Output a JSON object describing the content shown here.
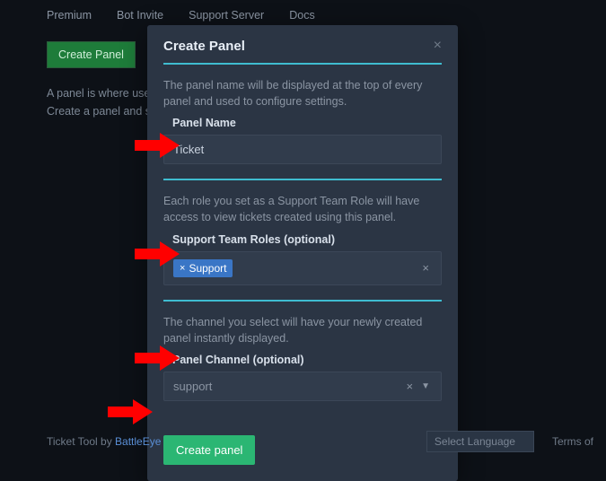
{
  "nav": {
    "premium": "Premium",
    "bot_invite": "Bot Invite",
    "support_server": "Support Server",
    "docs": "Docs"
  },
  "page": {
    "create_panel_btn": "Create Panel",
    "desc_line1": "A panel is where users c",
    "desc_line2": "Create a panel and sen"
  },
  "modal": {
    "title": "Create Panel",
    "section1": {
      "desc": "The panel name will be displayed at the top of every panel and used to configure settings.",
      "label": "Panel Name",
      "value": "Ticket"
    },
    "section2": {
      "desc": "Each role you set as a Support Team Role will have access to view tickets created using this panel.",
      "label": "Support Team Roles (optional)",
      "tag": "Support"
    },
    "section3": {
      "desc": "The channel you select will have your newly created panel instantly displayed.",
      "label": "Panel Channel (optional)",
      "value": "support"
    },
    "submit": "Create panel"
  },
  "footer": {
    "prefix": "Ticket Tool by ",
    "author": "BattleEye",
    "lang": "Select Language",
    "terms": "Terms of"
  }
}
